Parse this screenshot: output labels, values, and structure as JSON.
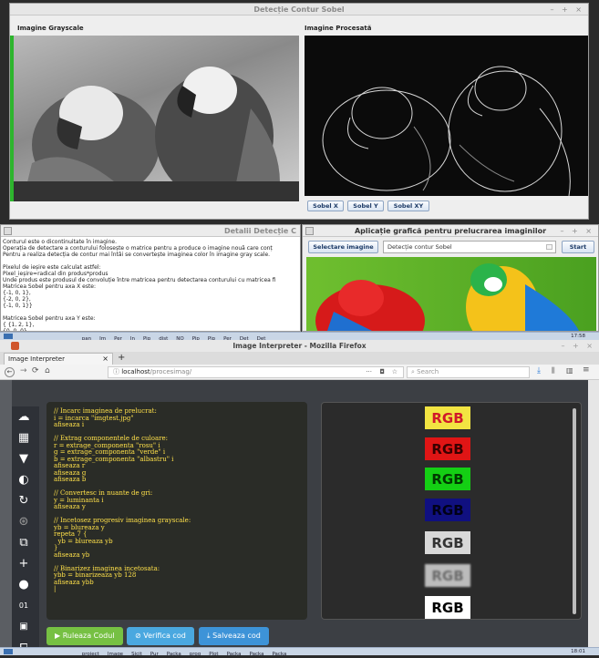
{
  "sobel": {
    "title": "Detecție Contur Sobel",
    "controls": "– + ×",
    "left_label": "Imagine Grayscale",
    "right_label": "Imagine Procesată",
    "buttons": [
      "Sobel X",
      "Sobel Y",
      "Sobel XY"
    ]
  },
  "detalii": {
    "title": "Detalii Detecție C",
    "text_lines": [
      "Conturul este o dicontinuitate în imagine.",
      "Operația de detectare a conturului folosește o matrice pentru a produce o imagine nouă care conț",
      "Pentru a realiza detecția de contur mai întâi se convertește imaginea color în imagine gray scale.",
      "",
      "Pixelul de ieșire este calculat astfel:",
      "Pixel_ieșire=radical din produs*produs",
      "Unde produs este produsul de convoluție între matricea pentru detectarea conturului cu matricea fi",
      "Matricea Sobel pentru axa X este:",
      "{-1, 0, 1},",
      "{-2, 0, 2},",
      "{-1, 0, 1}}",
      "",
      "Matricea Sobel pentru axa Y este:",
      "{ {1, 2, 1},",
      "{0, 0, 0},"
    ]
  },
  "aplicatie": {
    "title": "Aplicație grafică pentru prelucrarea imaginilor",
    "controls": "– + ×",
    "select_button": "Selectare imagine",
    "dropdown_value": "Detecție contur Sobel",
    "start_button": "Start"
  },
  "taskbar_top": {
    "items": [
      "pan",
      "Im",
      "Per",
      "In",
      "Pip",
      "dist",
      "NO",
      "Pip",
      "Pip",
      "Per",
      "Det",
      "Det"
    ],
    "clock": "17:58"
  },
  "firefox": {
    "window_title": "Image Interpreter - Mozilla Firefox",
    "controls": "– + ×",
    "tab_label": "Image Interpreter",
    "tab_close": "×",
    "new_tab": "+",
    "url_host": "localhost",
    "url_path": "/procesimag/",
    "url_dots": "···",
    "search_placeholder": "Search"
  },
  "editor": {
    "code_lines": [
      "// Incarc imaginea de prelucrat:",
      "i = incarca \"imgtest.jpg\"",
      "afiseaza i",
      "",
      "// Extrag componentele de culoare:",
      "r = extrage_componenta \"rosu\" i",
      "g = extrage_componenta \"verde\" i",
      "b = extrage_componenta \"albastru\" i",
      "afiseaza r",
      "afiseaza g",
      "afiseaza b",
      "",
      "// Convertesc in nuante de gri:",
      "y = luminanta i",
      "afiseaza y",
      "",
      "// Incetosez progresiv imaginea grayscale:",
      "yb = blureaza y",
      "repeta 7 {",
      "  yb = blureaza yb",
      "}",
      "afiseaza yb",
      "",
      "// Binarizez imaginea incetosata:",
      "ybb = binarizeaza yb 128",
      "afiseaza ybb",
      "|"
    ],
    "run_button": "Ruleaza Codul",
    "verify_button": "Verifica cod",
    "save_button": "Salveaza cod"
  },
  "output": {
    "thumb_text": "RGB",
    "thumbs": [
      {
        "name": "original",
        "bg": "#f2e442",
        "fg": "#d0182a"
      },
      {
        "name": "red",
        "bg": "#e01515",
        "fg": "#3a0000"
      },
      {
        "name": "green",
        "bg": "#14cf14",
        "fg": "#003a00"
      },
      {
        "name": "blue",
        "bg": "#101080",
        "fg": "#000018"
      },
      {
        "name": "gray",
        "bg": "#d8d8d8",
        "fg": "#333333"
      },
      {
        "name": "blur",
        "bg": "#bcbcbc",
        "fg": "#6a6a6a"
      },
      {
        "name": "binary",
        "bg": "#ffffff",
        "fg": "#000000"
      }
    ]
  },
  "taskbar_bottom": {
    "items": [
      "proiect",
      "Image",
      "Sicit",
      "Pur",
      "Packa",
      "prog",
      "Plot",
      "Packa",
      "Packa",
      "Packa"
    ],
    "clock": "18:01"
  }
}
